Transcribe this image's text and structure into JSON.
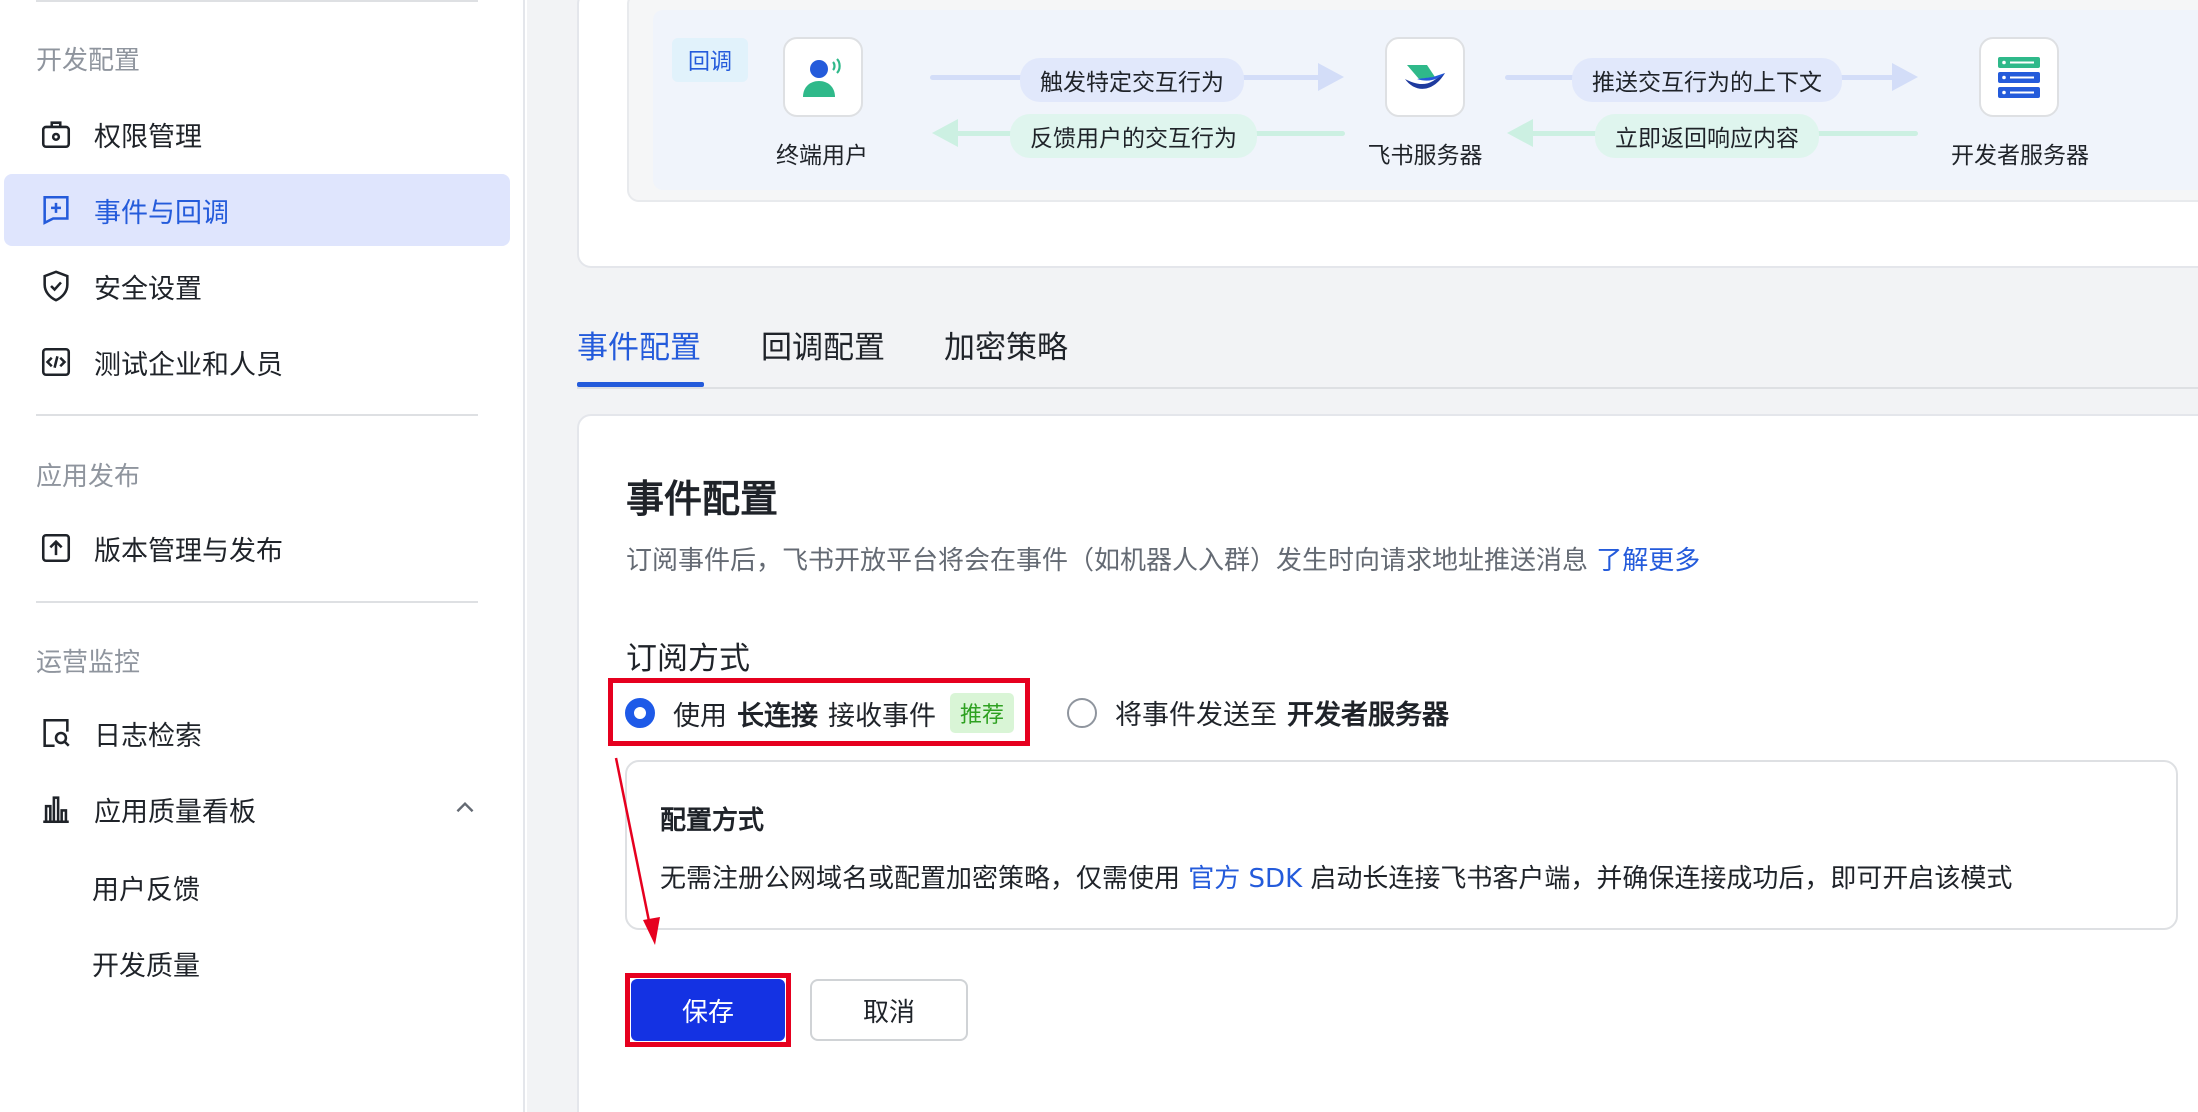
{
  "sidebar": {
    "sections": {
      "dev_config": "开发配置",
      "app_release": "应用发布",
      "ops_monitor": "运营监控"
    },
    "items": [
      {
        "label": "权限管理",
        "icon": "lock-bag-icon"
      },
      {
        "label": "事件与回调",
        "icon": "event-plus-icon",
        "active": true
      },
      {
        "label": "安全设置",
        "icon": "shield-check-icon"
      },
      {
        "label": "测试企业和人员",
        "icon": "code-box-icon"
      },
      {
        "label": "版本管理与发布",
        "icon": "upload-box-icon"
      },
      {
        "label": "日志检索",
        "icon": "log-search-icon"
      },
      {
        "label": "应用质量看板",
        "icon": "bar-chart-icon",
        "expanded": true
      }
    ],
    "sub_items": [
      "用户反馈",
      "开发质量"
    ]
  },
  "flow": {
    "tag": "回调",
    "nodes": [
      "终端用户",
      "飞书服务器",
      "开发者服务器"
    ],
    "arrows": {
      "trigger": "触发特定交互行为",
      "feedback": "反馈用户的交互行为",
      "push": "推送交互行为的上下文",
      "respond": "立即返回响应内容"
    }
  },
  "tabs": [
    {
      "label": "事件配置",
      "active": true
    },
    {
      "label": "回调配置"
    },
    {
      "label": "加密策略"
    }
  ],
  "config": {
    "title": "事件配置",
    "description": "订阅事件后，飞书开放平台将会在事件（如机器人入群）发生时向请求地址推送消息",
    "learn_more": "了解更多",
    "subscribe_label": "订阅方式",
    "option_long_conn": {
      "prefix": "使用",
      "bold": "长连接",
      "suffix": "接收事件",
      "badge": "推荐",
      "selected": true
    },
    "option_dev_server": {
      "prefix": "将事件发送至",
      "bold": "开发者服务器",
      "selected": false
    },
    "mode_title": "配置方式",
    "mode_desc_prefix": "无需注册公网域名或配置加密策略，仅需使用",
    "mode_desc_link": "官方 SDK",
    "mode_desc_suffix": "启动长连接飞书客户端，并确保连接成功后，即可开启该模式"
  },
  "buttons": {
    "save": "保存",
    "cancel": "取消"
  },
  "colors": {
    "accent": "#245bdb",
    "save_button": "#1432e3",
    "annotation": "#e6001f",
    "active_bg": "#dfe5fd"
  }
}
